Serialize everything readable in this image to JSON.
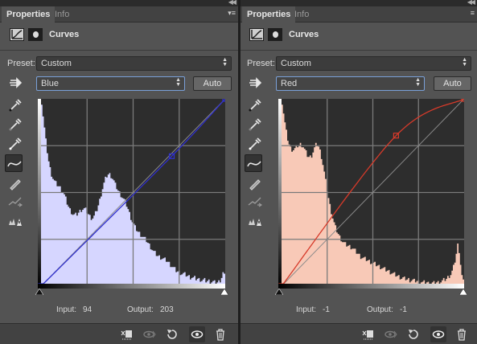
{
  "panels": [
    {
      "tabs": [
        {
          "label": "Properties"
        },
        {
          "label": "Info"
        }
      ],
      "title": "Curves",
      "preset_label": "Preset:",
      "preset_value": "Custom",
      "channel_value": "Blue",
      "auto_label": "Auto",
      "input_label": "Input:",
      "input_value": "94",
      "output_label": "Output:",
      "output_value": "203",
      "channel_color": "#2f2fcf",
      "fill_color": "#d6d6ff",
      "curve_points": [
        [
          0,
          0
        ],
        [
          181,
          177
        ],
        [
          255,
          255
        ]
      ],
      "histogram": [
        250,
        232,
        215,
        198,
        183,
        170,
        160,
        152,
        147,
        143,
        140,
        138,
        136,
        134,
        131,
        128,
        124,
        119,
        113,
        108,
        104,
        101,
        98,
        97,
        97,
        98,
        100,
        102,
        104,
        105,
        105,
        104,
        101,
        98,
        95,
        93,
        93,
        95,
        99,
        104,
        110,
        117,
        125,
        133,
        140,
        146,
        150,
        152,
        152,
        150,
        147,
        143,
        138,
        134,
        130,
        127,
        124,
        121,
        118,
        115,
        110,
        105,
        99,
        93,
        88,
        84,
        80,
        77,
        74,
        72,
        70,
        68,
        66,
        64,
        62,
        59,
        56,
        53,
        50,
        47,
        45,
        43,
        41,
        40,
        39,
        38,
        37,
        36,
        35,
        33,
        31,
        29,
        27,
        25,
        23,
        21,
        20,
        19,
        18,
        17,
        17,
        16,
        15,
        14,
        13,
        12,
        12,
        11,
        11,
        10,
        10,
        9,
        9,
        8,
        8,
        8,
        7,
        7,
        7,
        6,
        6,
        6,
        5,
        5,
        5,
        6,
        8,
        12,
        18,
        14
      ]
    },
    {
      "tabs": [
        {
          "label": "Properties"
        },
        {
          "label": "Info"
        }
      ],
      "title": "Curves",
      "preset_label": "Preset:",
      "preset_value": "Custom",
      "channel_value": "Red",
      "auto_label": "Auto",
      "input_label": "Input:",
      "input_value": "-1",
      "output_label": "Output:",
      "output_value": "-1",
      "channel_color": "#d63a2a",
      "fill_color": "#f8c9b7",
      "curve_points": [
        [
          0,
          0
        ],
        [
          160,
          205
        ],
        [
          255,
          255
        ]
      ],
      "histogram": [
        250,
        236,
        222,
        210,
        200,
        193,
        188,
        186,
        186,
        187,
        189,
        191,
        192,
        193,
        192,
        190,
        186,
        182,
        178,
        176,
        176,
        178,
        183,
        188,
        192,
        193,
        190,
        184,
        176,
        166,
        155,
        143,
        131,
        120,
        110,
        101,
        93,
        86,
        80,
        75,
        71,
        67,
        64,
        61,
        59,
        57,
        56,
        55,
        54,
        53,
        52,
        50,
        48,
        46,
        44,
        42,
        40,
        39,
        38,
        37,
        36,
        35,
        34,
        33,
        32,
        31,
        30,
        29,
        28,
        27,
        26,
        25,
        24,
        23,
        22,
        21,
        20,
        19,
        18,
        17,
        16,
        15,
        14,
        13,
        12,
        11,
        11,
        10,
        10,
        9,
        9,
        8,
        8,
        8,
        7,
        7,
        7,
        6,
        6,
        6,
        5,
        5,
        5,
        5,
        4,
        4,
        4,
        4,
        4,
        4,
        5,
        5,
        6,
        6,
        7,
        8,
        9,
        10,
        12,
        14,
        16,
        20,
        26,
        34,
        44,
        56,
        48,
        30,
        14,
        6
      ]
    }
  ]
}
